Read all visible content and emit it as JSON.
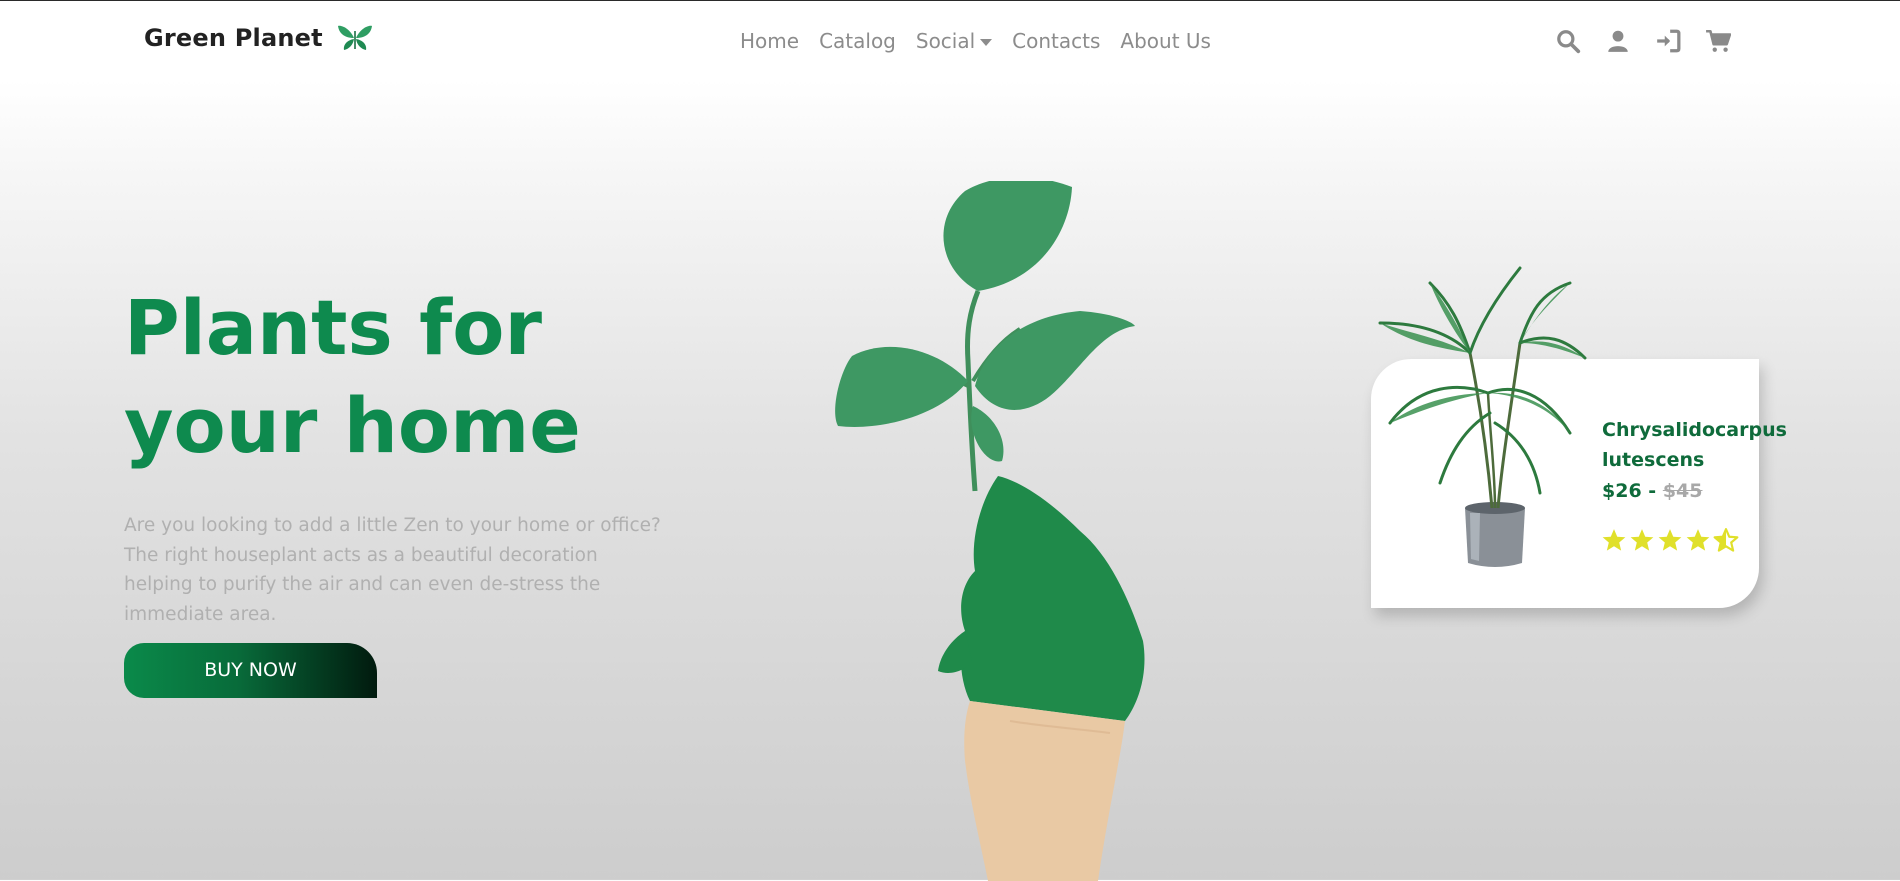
{
  "brand": {
    "name": "Green Planet",
    "logo_icon": "leaf-butterfly-icon"
  },
  "nav": {
    "links": [
      {
        "label": "Home"
      },
      {
        "label": "Catalog"
      },
      {
        "label": "Social",
        "has_dropdown": true
      },
      {
        "label": "Contacts"
      },
      {
        "label": "About Us"
      }
    ],
    "icons": [
      "search-icon",
      "user-icon",
      "login-icon",
      "cart-icon"
    ]
  },
  "hero": {
    "title_line1": "Plants for",
    "title_line2": "your home",
    "description": "Are you looking to add a little Zen to your home or office? The right houseplant acts as a beautiful decoration helping to purify the air and can even de-stress the immediate area.",
    "cta_label": "BUY NOW"
  },
  "product": {
    "name_line1": "Chrysalidocarpus",
    "name_line2": "lutescens",
    "price": "$26",
    "separator": "-",
    "old_price": "$45",
    "rating": 4.5,
    "rating_max": 5
  },
  "colors": {
    "accent_green": "#0e8a4e",
    "dark_green": "#0f6b3b",
    "star_yellow": "#e0e02a",
    "muted_text": "#b0b0b0"
  }
}
